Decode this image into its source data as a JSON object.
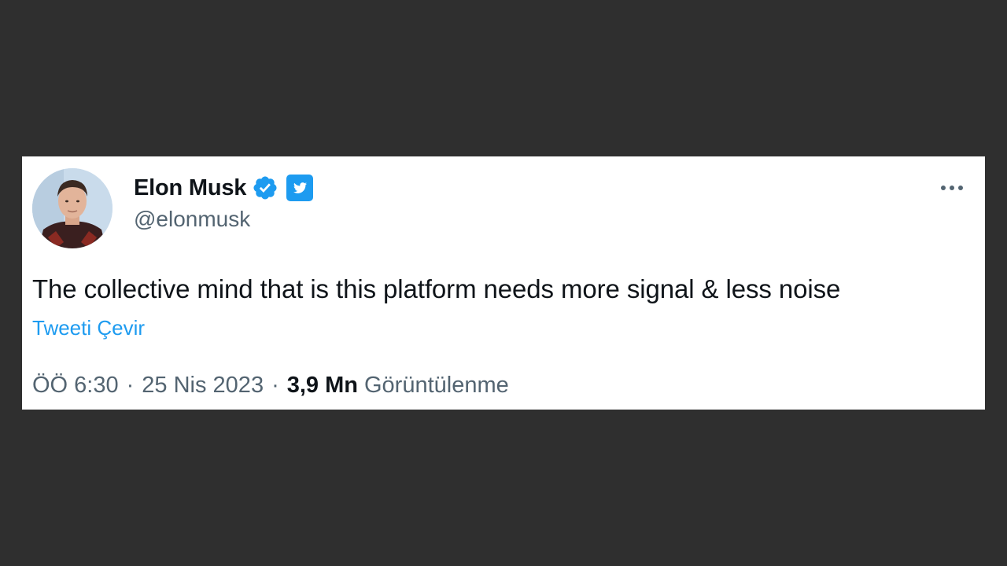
{
  "author": {
    "display_name": "Elon Musk",
    "handle": "@elonmusk",
    "avatar": "avatar-photo",
    "verified_icon": "verified-badge-icon",
    "affiliate_icon": "twitter-bird-icon"
  },
  "tweet": {
    "text": "The collective mind that is this platform needs more signal & less noise",
    "translate_label": "Tweeti Çevir"
  },
  "meta": {
    "time": "ÖÖ 6:30",
    "separator": "·",
    "date": "25 Nis 2023",
    "views_count": "3,9 Mn",
    "views_label": "Görüntülenme"
  },
  "more_icon": "more-horizontal-icon",
  "colors": {
    "background": "#2f2f2f",
    "card": "#ffffff",
    "accent": "#1d9bf0",
    "text_primary": "#0f1419",
    "text_secondary": "#536471"
  }
}
